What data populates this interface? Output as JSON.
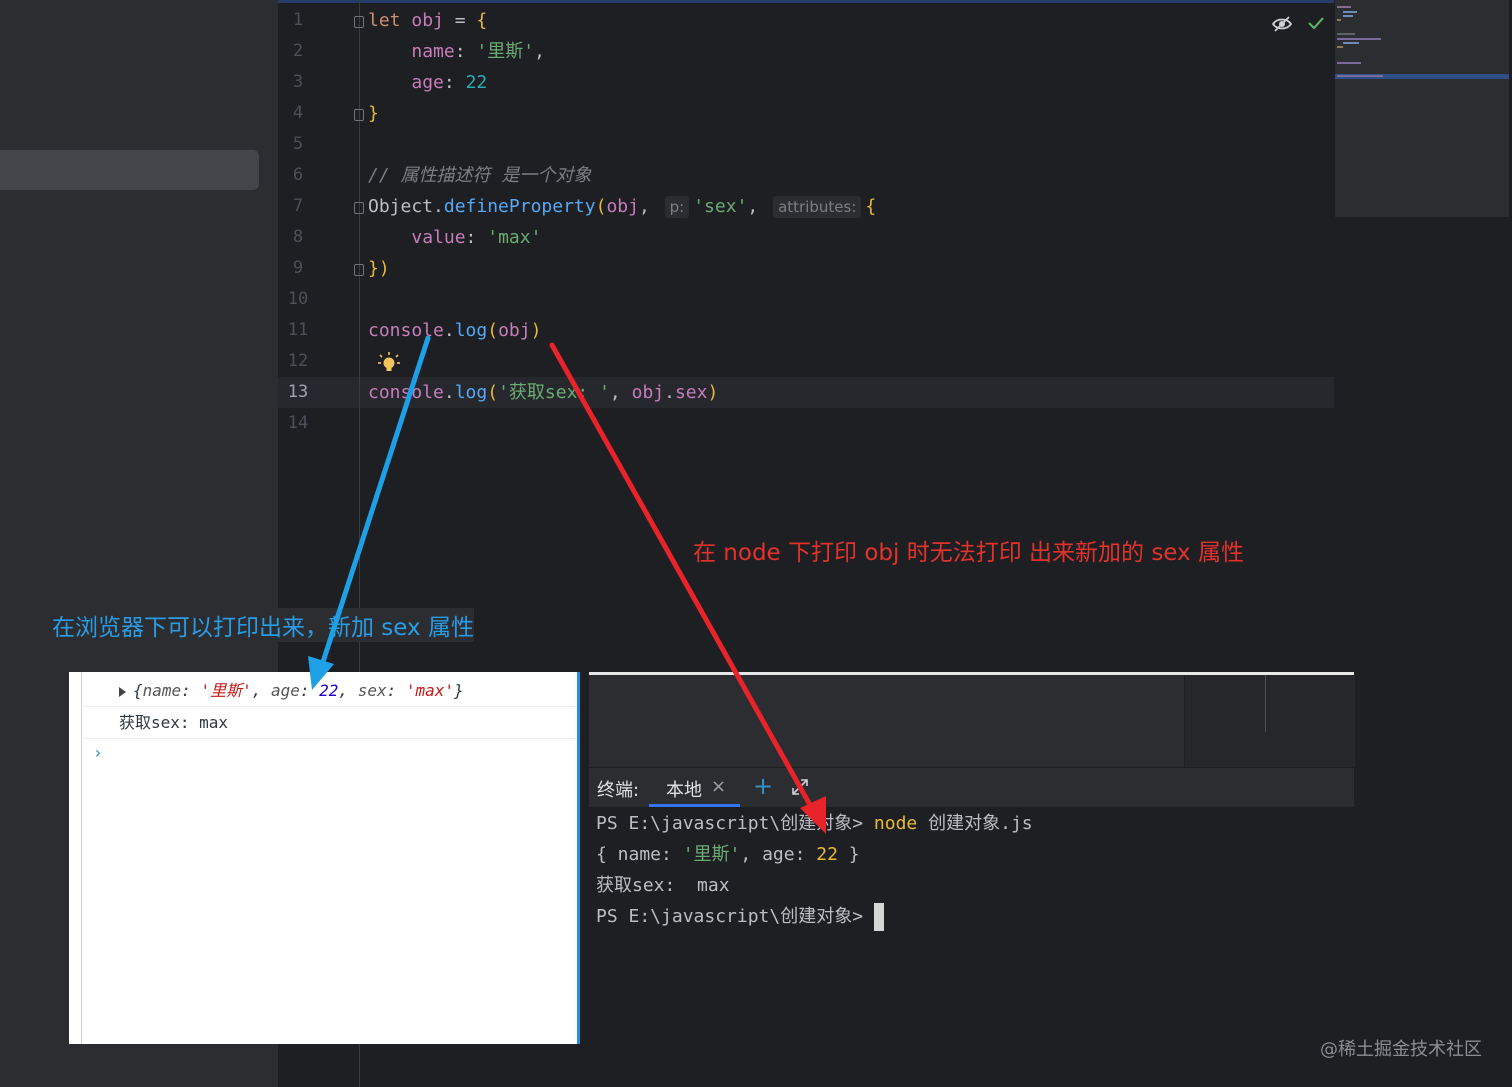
{
  "editor": {
    "line_numbers": [
      "1",
      "2",
      "3",
      "4",
      "5",
      "6",
      "7",
      "8",
      "9",
      "10",
      "11",
      "12",
      "13",
      "14"
    ],
    "lines": {
      "l1_kw": "let",
      "l1_var": "obj",
      "l1_rest": " = ",
      "l1_brace": "{",
      "l2_prop": "name",
      "l2_colon": ": ",
      "l2_str": "'里斯'",
      "l2_comma": ",",
      "l3_prop": "age",
      "l3_colon": ": ",
      "l3_num": "22",
      "l4_brace": "}",
      "l6_comment": "// 属性描述符 是一个对象",
      "l7_obj": "Object",
      "l7_dot": ".",
      "l7_fn": "defineProperty",
      "l7_open": "(",
      "l7_arg": "obj",
      "l7_comma": ",",
      "l7_hint_p": "p:",
      "l7_str": "'sex'",
      "l7_comma2": ",",
      "l7_hint_attr": "attributes:",
      "l7_brace": "{",
      "l8_prop": "value",
      "l8_colon": ": ",
      "l8_str": "'max'",
      "l9_close": "})",
      "l11_console": "console",
      "l11_dot": ".",
      "l11_fn": "log",
      "l11_open": "(",
      "l11_arg": "obj",
      "l11_close": ")",
      "l13_console": "console",
      "l13_dot": ".",
      "l13_fn": "log",
      "l13_open": "(",
      "l13_str": "'获取sex: '",
      "l13_comma": ", ",
      "l13_obj": "obj",
      "l13_dot2": ".",
      "l13_prop": "sex",
      "l13_close": ")"
    }
  },
  "annotations": {
    "red": "在 node 下打印 obj 时无法打印 出来新加的 sex 属性",
    "blue": "在浏览器下可以打印出来，新加 sex 属性"
  },
  "devtools": {
    "obj_open": "{",
    "k_name": "name",
    "colon": ": ",
    "v_name": "'里斯'",
    "sep": ", ",
    "k_age": "age",
    "v_age": "22",
    "k_sex": "sex",
    "v_sex": "'max'",
    "obj_close": "}",
    "log_line": "获取sex:  max",
    "prompt": "›"
  },
  "terminal": {
    "title": "终端:",
    "tab_label": "本地",
    "close_glyph": "×",
    "add_glyph": "+",
    "line1_prompt": "PS E:\\javascript\\创建对象> ",
    "line1_cmd": "node",
    "line1_arg": " 创建对象.js",
    "line2_a": "{ name: ",
    "line2_str": "'里斯'",
    "line2_b": ", age: ",
    "line2_num": "22",
    "line2_c": " }",
    "line3": "获取sex:  max",
    "line4_prompt": "PS E:\\javascript\\创建对象> "
  },
  "watermark": "@稀土掘金技术社区",
  "colors": {
    "red_arrow": "#e8232a",
    "blue_arrow": "#1ea0e6",
    "accent": "#3574f0"
  }
}
